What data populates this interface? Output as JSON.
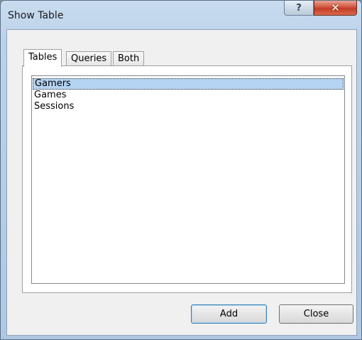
{
  "window": {
    "title": "Show Table",
    "help_label": "?",
    "close_label": "✕"
  },
  "tabs": [
    {
      "label": "Tables",
      "active": true
    },
    {
      "label": "Queries",
      "active": false
    },
    {
      "label": "Both",
      "active": false
    }
  ],
  "list": {
    "items": [
      {
        "label": "Gamers",
        "selected": true
      },
      {
        "label": "Games",
        "selected": false
      },
      {
        "label": "Sessions",
        "selected": false
      }
    ]
  },
  "buttons": {
    "add_label": "Add",
    "close_label": "Close"
  }
}
